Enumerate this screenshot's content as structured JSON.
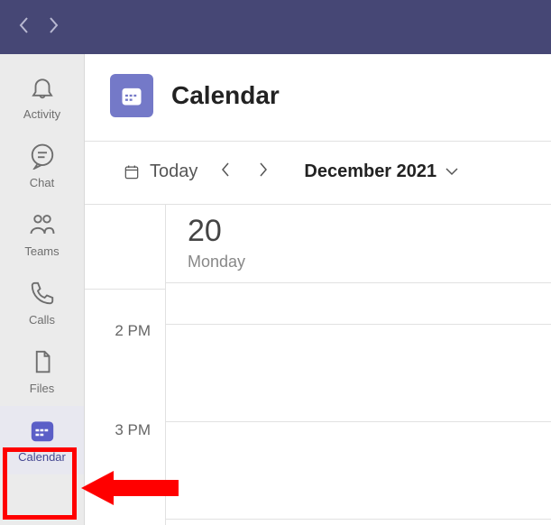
{
  "rail": {
    "activity": "Activity",
    "chat": "Chat",
    "teams": "Teams",
    "calls": "Calls",
    "files": "Files",
    "calendar": "Calendar"
  },
  "header": {
    "title": "Calendar"
  },
  "toolbar": {
    "today_label": "Today",
    "date_label": "December 2021"
  },
  "day": {
    "num": "20",
    "dow": "Monday"
  },
  "times": {
    "t2": "2 PM",
    "t3": "3 PM"
  }
}
